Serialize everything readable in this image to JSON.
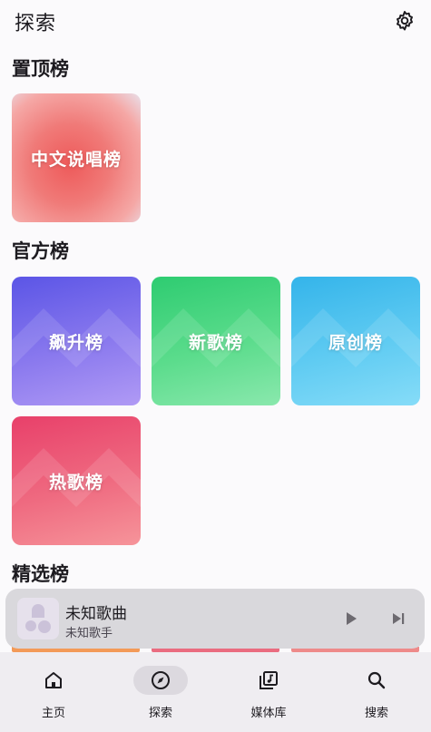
{
  "header": {
    "title": "探索",
    "settings_icon": "gear-icon"
  },
  "sections": {
    "pinned": {
      "title": "置顶榜",
      "items": [
        {
          "label": "中文说唱榜"
        }
      ]
    },
    "official": {
      "title": "官方榜",
      "items": [
        {
          "label": "飙升榜"
        },
        {
          "label": "新歌榜"
        },
        {
          "label": "原创榜"
        },
        {
          "label": "热歌榜"
        }
      ]
    },
    "featured": {
      "title": "精选榜"
    }
  },
  "player": {
    "title": "未知歌曲",
    "artist": "未知歌手",
    "play_icon": "play-icon",
    "next_icon": "skip-next-icon"
  },
  "nav": {
    "items": [
      {
        "label": "主页",
        "icon": "home-icon"
      },
      {
        "label": "探索",
        "icon": "compass-icon",
        "active": true
      },
      {
        "label": "媒体库",
        "icon": "library-icon"
      },
      {
        "label": "搜索",
        "icon": "search-icon"
      }
    ]
  },
  "colors": {
    "accent_soar": "#6b63ea",
    "accent_new": "#3dd37c",
    "accent_orig": "#45bff0",
    "accent_hot": "#ec5274",
    "accent_zh": "#ef6b6b"
  }
}
